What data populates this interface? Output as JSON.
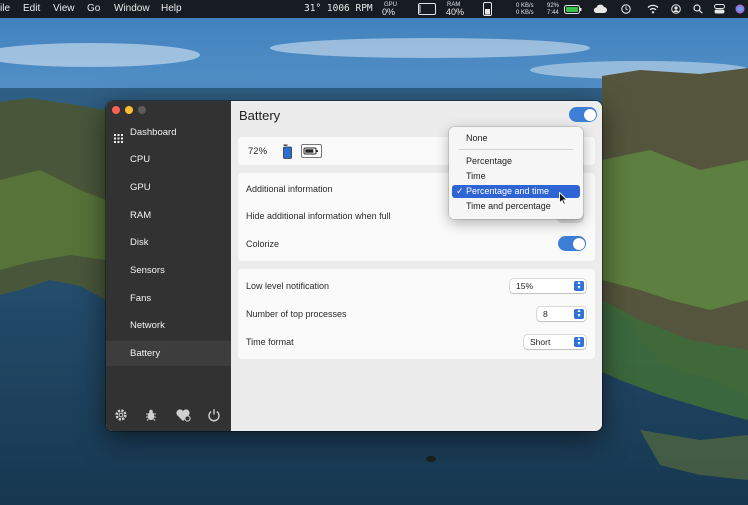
{
  "menubar": {
    "app_menu_partial": "ile",
    "menus": [
      "Edit",
      "View",
      "Go",
      "Window",
      "Help"
    ],
    "temp_fan": "31° 1006 RPM",
    "gpu": {
      "label": "GPU",
      "value": "0%"
    },
    "ram": {
      "label": "RAM",
      "value": "40%"
    },
    "network": {
      "up": "0 KB/s",
      "down": "0 KB/s"
    },
    "battery": {
      "percent": "92%",
      "time": "7:44"
    },
    "icons": [
      "cpu-box-icon",
      "ram-bar-icon",
      "battery-icon",
      "cloud-icon",
      "clock-icon",
      "wifi-icon",
      "user-icon",
      "search-icon",
      "control-center-icon",
      "siri-icon"
    ]
  },
  "sidebar": {
    "dashboard": "Dashboard",
    "items": [
      "CPU",
      "GPU",
      "RAM",
      "Disk",
      "Sensors",
      "Fans",
      "Network",
      "Battery"
    ],
    "active": "Battery",
    "footer_icons": [
      "settings-gear-icon",
      "bug-icon",
      "support-heart-icon",
      "power-icon"
    ]
  },
  "main": {
    "title": "Battery",
    "module_enabled": true,
    "preview": {
      "percent": "72%"
    },
    "additional_information": "Additional information",
    "hide_additional": "Hide additional information when full",
    "colorize": "Colorize",
    "colorize_on": true,
    "low_level": {
      "label": "Low level notification",
      "value": "15%"
    },
    "top_processes": {
      "label": "Number of top processes",
      "value": "8"
    },
    "time_format": {
      "label": "Time format",
      "value": "Short"
    }
  },
  "dropdown": {
    "items": [
      "None",
      "Percentage",
      "Time",
      "Percentage and time",
      "Time and percentage"
    ],
    "selected": "Percentage and time",
    "checkmark": "✓"
  },
  "colors": {
    "accent": "#2e64d4",
    "toggle_on": "#3d7fd6",
    "sidebar_bg": "#323232",
    "close": "#fe5f57",
    "minimize": "#febc2e"
  }
}
